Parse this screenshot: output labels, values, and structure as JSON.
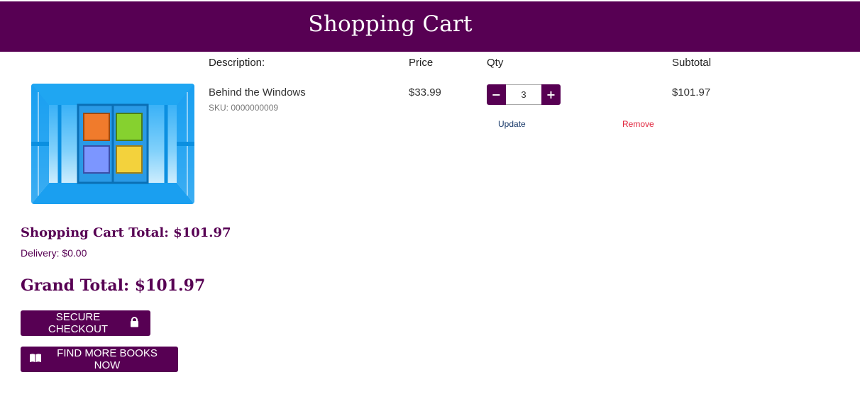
{
  "header": {
    "title": "Shopping Cart"
  },
  "table": {
    "headers": {
      "description": "Description:",
      "price": "Price",
      "qty": "Qty",
      "subtotal": "Subtotal"
    }
  },
  "item": {
    "title": "Behind the Windows",
    "sku": "SKU: 0000000009",
    "price": "$33.99",
    "quantity": "3",
    "subtotal": "$101.97",
    "update_label": "Update",
    "remove_label": "Remove",
    "minus_label": "−",
    "plus_label": "+"
  },
  "summary": {
    "cart_total": "Shopping Cart Total: $101.97",
    "delivery": "Delivery: $0.00",
    "grand_total": "Grand Total: $101.97"
  },
  "actions": {
    "checkout_label": "SECURE CHECKOUT",
    "checkout_icon": "lock-icon",
    "find_label": "FIND MORE BOOKS NOW",
    "find_icon": "book-open-icon"
  },
  "colors": {
    "brand": "#570053",
    "remove": "#e0233b",
    "update": "#1a3a6a"
  }
}
